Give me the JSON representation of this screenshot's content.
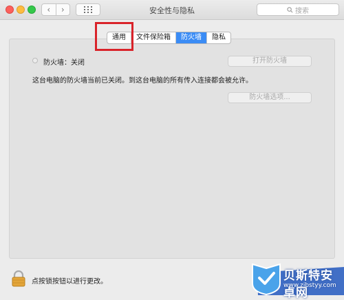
{
  "window": {
    "title": "安全性与隐私"
  },
  "search": {
    "placeholder": "搜索"
  },
  "tabs": [
    {
      "label": "通用",
      "active": false
    },
    {
      "label": "文件保险箱",
      "active": false
    },
    {
      "label": "防火墙",
      "active": true
    },
    {
      "label": "隐私",
      "active": false
    }
  ],
  "firewall": {
    "status": "防火墙：关闭",
    "turn_on_button": "打开防火墙",
    "description": "这台电脑的防火墙当前已关闭。到这台电脑的所有传入连接都会被允许。",
    "options_button": "防火墙选项..."
  },
  "footer": {
    "lock_text": "点按锁按钮以进行更改。"
  },
  "watermark": {
    "name": "贝斯特安卓网",
    "url": "www.zjbstyy.com"
  },
  "colors": {
    "accent": "#3b8cf5",
    "highlight": "#d9232a"
  }
}
